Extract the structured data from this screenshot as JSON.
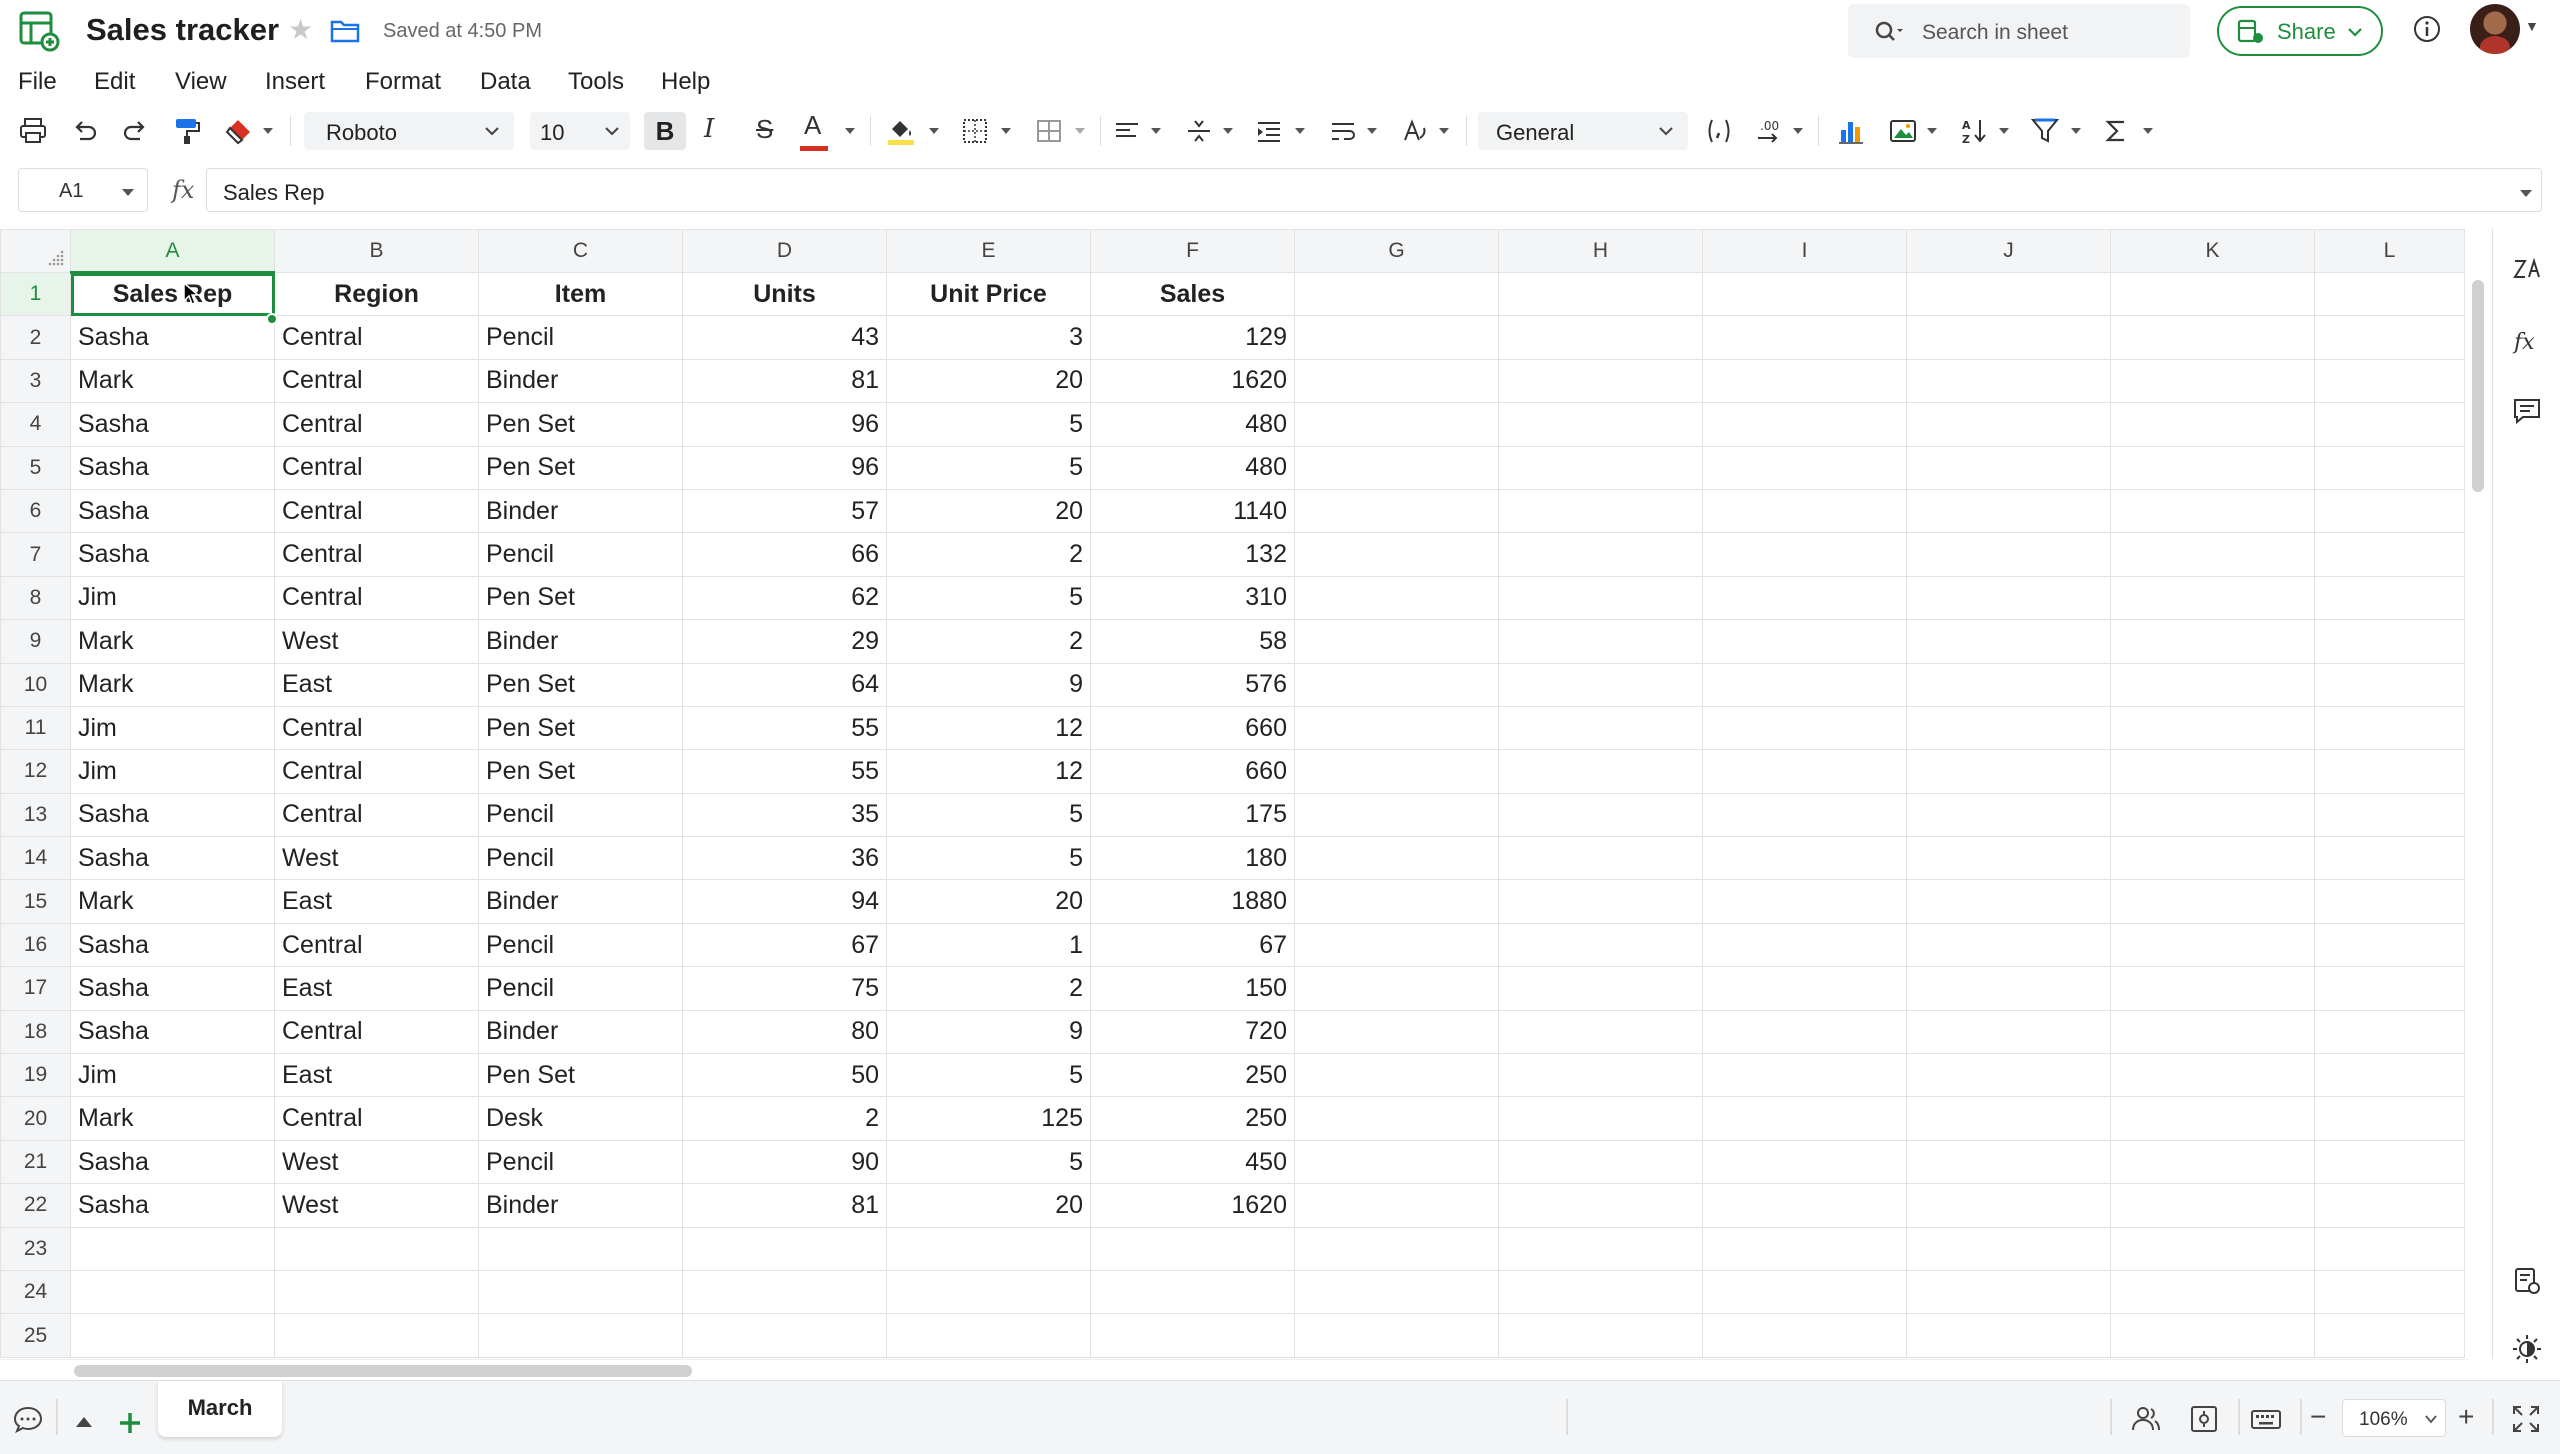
{
  "app": {
    "doc_title": "Sales tracker",
    "saved_status": "Saved at 4:50 PM",
    "search_placeholder": "Search in sheet",
    "share_label": "Share"
  },
  "menu": [
    "File",
    "Edit",
    "View",
    "Insert",
    "Format",
    "Data",
    "Tools",
    "Help"
  ],
  "toolbar": {
    "font_family": "Roboto",
    "font_size": "10",
    "bold": "B",
    "italic": "I",
    "strike": "S",
    "font_color_letter": "A",
    "number_format": "General",
    "text_color": "#d93025",
    "fill_color": "#f9e04b"
  },
  "formula_bar": {
    "cell_ref": "A1",
    "fx": "fx",
    "content": "Sales Rep"
  },
  "sheet": {
    "columns": [
      "A",
      "B",
      "C",
      "D",
      "E",
      "F",
      "G",
      "H",
      "I",
      "J",
      "K",
      "L"
    ],
    "active_column": "A",
    "active_row": 1,
    "headers": [
      "Sales Rep",
      "Region",
      "Item",
      "Units",
      "Unit Price",
      "Sales"
    ],
    "rows": [
      [
        "Sasha",
        "Central",
        "Pencil",
        "43",
        "3",
        "129"
      ],
      [
        "Mark",
        "Central",
        "Binder",
        "81",
        "20",
        "1620"
      ],
      [
        "Sasha",
        "Central",
        "Pen Set",
        "96",
        "5",
        "480"
      ],
      [
        "Sasha",
        "Central",
        "Pen Set",
        "96",
        "5",
        "480"
      ],
      [
        "Sasha",
        "Central",
        "Binder",
        "57",
        "20",
        "1140"
      ],
      [
        "Sasha",
        "Central",
        "Pencil",
        "66",
        "2",
        "132"
      ],
      [
        "Jim",
        "Central",
        "Pen Set",
        "62",
        "5",
        "310"
      ],
      [
        "Mark",
        "West",
        "Binder",
        "29",
        "2",
        "58"
      ],
      [
        "Mark",
        "East",
        "Pen Set",
        "64",
        "9",
        "576"
      ],
      [
        "Jim",
        "Central",
        "Pen Set",
        "55",
        "12",
        "660"
      ],
      [
        "Jim",
        "Central",
        "Pen Set",
        "55",
        "12",
        "660"
      ],
      [
        "Sasha",
        "Central",
        "Pencil",
        "35",
        "5",
        "175"
      ],
      [
        "Sasha",
        "West",
        "Pencil",
        "36",
        "5",
        "180"
      ],
      [
        "Mark",
        "East",
        "Binder",
        "94",
        "20",
        "1880"
      ],
      [
        "Sasha",
        "Central",
        "Pencil",
        "67",
        "1",
        "67"
      ],
      [
        "Sasha",
        "East",
        "Pencil",
        "75",
        "2",
        "150"
      ],
      [
        "Sasha",
        "Central",
        "Binder",
        "80",
        "9",
        "720"
      ],
      [
        "Jim",
        "East",
        "Pen Set",
        "50",
        "5",
        "250"
      ],
      [
        "Mark",
        "Central",
        "Desk",
        "2",
        "125",
        "250"
      ],
      [
        "Sasha",
        "West",
        "Pencil",
        "90",
        "5",
        "450"
      ],
      [
        "Sasha",
        "West",
        "Binder",
        "81",
        "20",
        "1620"
      ]
    ],
    "row_numbers": [
      "1",
      "2",
      "3",
      "4",
      "5",
      "6",
      "7",
      "8",
      "9",
      "10",
      "11",
      "12",
      "13",
      "14",
      "15",
      "16",
      "17",
      "18",
      "19",
      "20",
      "21",
      "22",
      "23",
      "24",
      "25"
    ]
  },
  "tabs": [
    {
      "label": "March",
      "active": true
    }
  ],
  "zoom": "106%",
  "colors": {
    "accent": "#1e8e3e",
    "header_bg": "#f4f5f6",
    "grid_line": "#e2e2e2"
  }
}
